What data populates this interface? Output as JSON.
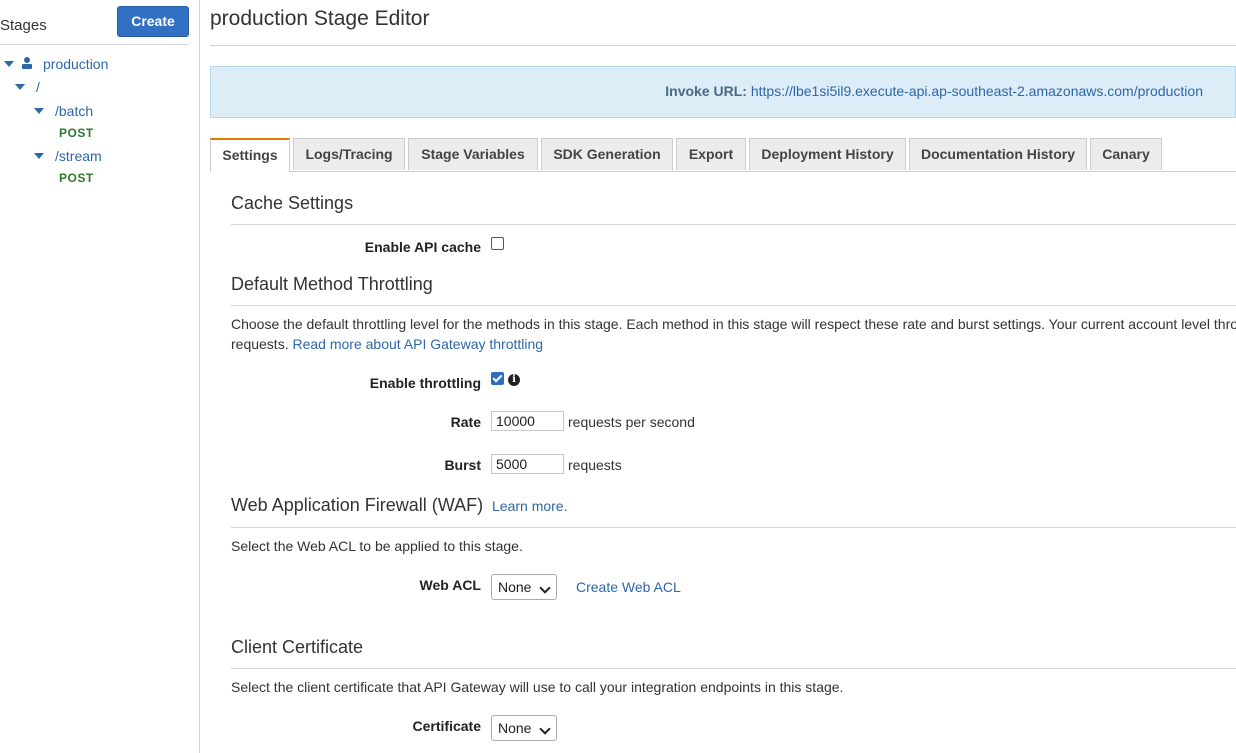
{
  "sidebar": {
    "title": "Stages",
    "create_label": "Create",
    "tree": {
      "stage": "production",
      "root": "/",
      "resources": [
        {
          "path": "/batch",
          "method": "POST"
        },
        {
          "path": "/stream",
          "method": "POST"
        }
      ]
    }
  },
  "main": {
    "title": "production Stage Editor",
    "invoke": {
      "label": "Invoke URL:",
      "url": "https://lbe1si5il9.execute-api.ap-southeast-2.amazonaws.com/production"
    },
    "tabs": [
      "Settings",
      "Logs/Tracing",
      "Stage Variables",
      "SDK Generation",
      "Export",
      "Deployment History",
      "Documentation History",
      "Canary"
    ],
    "active_tab": "Settings",
    "cache": {
      "heading": "Cache Settings",
      "enable_label": "Enable API cache",
      "enabled": false
    },
    "throttling": {
      "heading": "Default Method Throttling",
      "description": "Choose the default throttling level for the methods in this stage. Each method in this stage will respect these rate and burst settings. Your current account level thro",
      "description_line2": "requests.",
      "read_more": "Read more about API Gateway throttling",
      "enable_label": "Enable throttling",
      "enabled": true,
      "rate_label": "Rate",
      "rate_value": "10000",
      "rate_unit": "requests per second",
      "burst_label": "Burst",
      "burst_value": "5000",
      "burst_unit": "requests"
    },
    "waf": {
      "heading": "Web Application Firewall (WAF)",
      "learn_more": "Learn more.",
      "description": "Select the Web ACL to be applied to this stage.",
      "acl_label": "Web ACL",
      "acl_value": "None",
      "create_link": "Create Web ACL"
    },
    "client_cert": {
      "heading": "Client Certificate",
      "description": "Select the client certificate that API Gateway will use to call your integration endpoints in this stage.",
      "cert_label": "Certificate",
      "cert_value": "None"
    }
  },
  "colors": {
    "accent": "#3270c3",
    "link": "#2e67a8",
    "method": "#2d7a2d",
    "active_tab": "#e07b00",
    "invoke_bg": "#dcedf7"
  }
}
